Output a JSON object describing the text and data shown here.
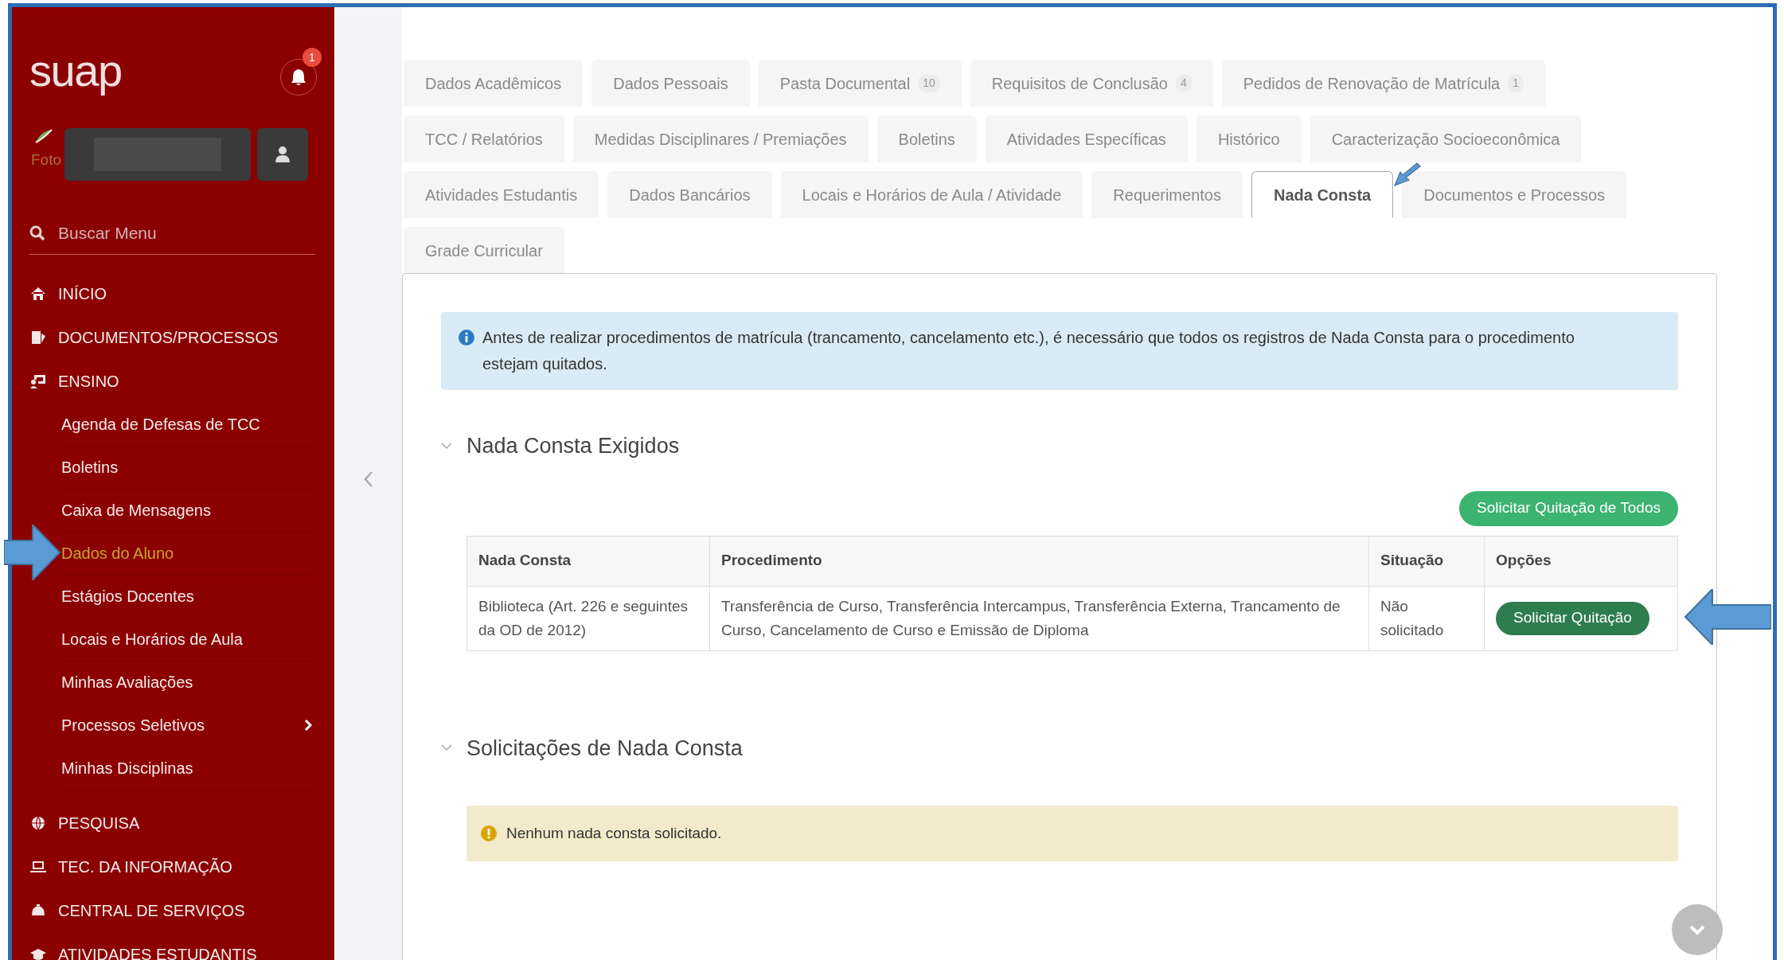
{
  "sidebar": {
    "logo": "suap",
    "notification_count": "1",
    "photo_label": "Foto",
    "search": {
      "placeholder": "Buscar Menu"
    },
    "menu": [
      {
        "label": "INÍCIO"
      },
      {
        "label": "DOCUMENTOS/PROCESSOS"
      },
      {
        "label": "ENSINO",
        "children": [
          {
            "label": "Agenda de Defesas de TCC",
            "selected": false,
            "has_submenu": false
          },
          {
            "label": "Boletins",
            "selected": false,
            "has_submenu": false
          },
          {
            "label": "Caixa de Mensagens",
            "selected": false,
            "has_submenu": false
          },
          {
            "label": "Dados do Aluno",
            "selected": true,
            "has_submenu": false
          },
          {
            "label": "Estágios Docentes",
            "selected": false,
            "has_submenu": false
          },
          {
            "label": "Locais e Horários de Aula",
            "selected": false,
            "has_submenu": false
          },
          {
            "label": "Minhas Avaliações",
            "selected": false,
            "has_submenu": false
          },
          {
            "label": "Processos Seletivos",
            "selected": false,
            "has_submenu": true
          },
          {
            "label": "Minhas Disciplinas",
            "selected": false,
            "has_submenu": false
          }
        ]
      },
      {
        "label": "PESQUISA"
      },
      {
        "label": "TEC. DA INFORMAÇÃO"
      },
      {
        "label": "CENTRAL DE SERVIÇOS"
      },
      {
        "label": "ATIVIDADES ESTUDANTIS"
      }
    ]
  },
  "tab_rows": [
    [
      {
        "label": "Dados Acadêmicos",
        "selected": false
      },
      {
        "label": "Dados Pessoais",
        "selected": false
      },
      {
        "label": "Pasta Documental",
        "count": "10",
        "selected": false
      },
      {
        "label": "Requisitos de Conclusão",
        "count": "4",
        "selected": false
      },
      {
        "label": "Pedidos de Renovação de Matrícula",
        "count": "1",
        "selected": false
      }
    ],
    [
      {
        "label": "TCC / Relatórios",
        "selected": false
      },
      {
        "label": "Medidas Disciplinares / Premiações",
        "selected": false
      },
      {
        "label": "Boletins",
        "selected": false
      },
      {
        "label": "Atividades Específicas",
        "selected": false
      },
      {
        "label": "Histórico",
        "selected": false
      },
      {
        "label": "Caracterização Socioeconômica",
        "selected": false
      }
    ],
    [
      {
        "label": "Atividades Estudantis",
        "selected": false
      },
      {
        "label": "Dados Bancários",
        "selected": false
      },
      {
        "label": "Locais e Horários de Aula / Atividade",
        "selected": false
      },
      {
        "label": "Requerimentos",
        "selected": false
      },
      {
        "label": "Nada Consta",
        "selected": true
      },
      {
        "label": "Documentos e Processos",
        "selected": false
      }
    ],
    [
      {
        "label": "Grade Curricular",
        "selected": false
      }
    ]
  ],
  "info_alert": "Antes de realizar procedimentos de matrícula (trancamento, cancelamento etc.), é necessário que todos os registros de Nada Consta para o procedimento estejam quitados.",
  "sections": [
    {
      "kind": "table",
      "title": "Nada Consta Exigidos",
      "expanded": true,
      "action": "Solicitar Quitação de Todos",
      "table": {
        "columns": [
          "Nada Consta",
          "Procedimento",
          "Situação",
          "Opções"
        ],
        "rows": [
          {
            "nada_consta": "Biblioteca (Art. 226 e seguintes da OD de 2012)",
            "procedimento": "Transferência de Curso, Transferência Intercampus, Transferência Externa, Trancamento de Curso, Cancelamento de Curso e Emissão de Diploma",
            "situacao": "Não solicitado",
            "option": "Solicitar Quitação"
          }
        ]
      }
    },
    {
      "kind": "notice",
      "title": "Solicitações de Nada Consta",
      "expanded": true,
      "message": "Nenhum nada consta solicitado."
    }
  ]
}
